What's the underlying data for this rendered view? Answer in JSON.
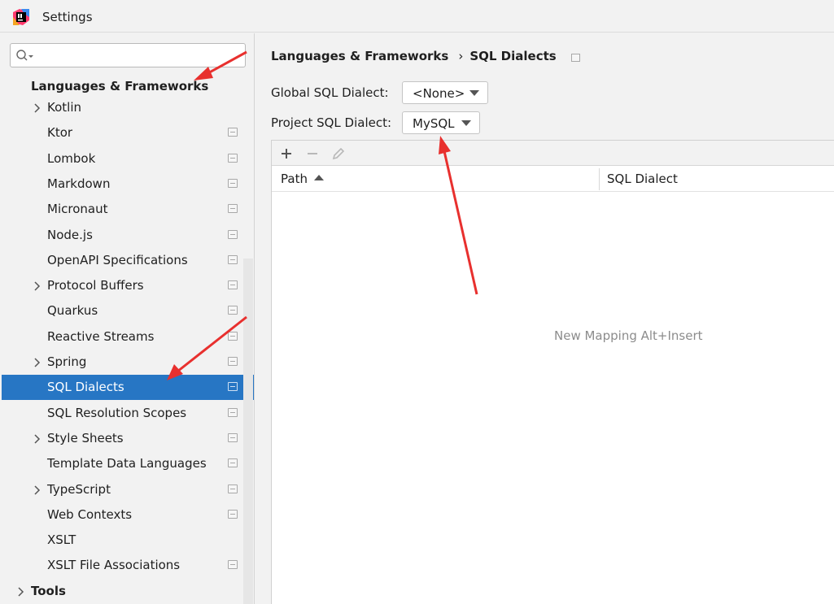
{
  "window": {
    "title": "Settings"
  },
  "search": {
    "value": "",
    "placeholder": ""
  },
  "sidebar": {
    "section_heading": "Languages & Frameworks",
    "items": [
      {
        "label": "Kotlin",
        "expandable": true,
        "page_icon": false
      },
      {
        "label": "Ktor",
        "expandable": false,
        "page_icon": true
      },
      {
        "label": "Lombok",
        "expandable": false,
        "page_icon": true
      },
      {
        "label": "Markdown",
        "expandable": false,
        "page_icon": true
      },
      {
        "label": "Micronaut",
        "expandable": false,
        "page_icon": true
      },
      {
        "label": "Node.js",
        "expandable": false,
        "page_icon": true
      },
      {
        "label": "OpenAPI Specifications",
        "expandable": false,
        "page_icon": true
      },
      {
        "label": "Protocol Buffers",
        "expandable": true,
        "page_icon": true
      },
      {
        "label": "Quarkus",
        "expandable": false,
        "page_icon": true
      },
      {
        "label": "Reactive Streams",
        "expandable": false,
        "page_icon": true
      },
      {
        "label": "Spring",
        "expandable": true,
        "page_icon": true
      },
      {
        "label": "SQL Dialects",
        "expandable": false,
        "page_icon": true,
        "selected": true
      },
      {
        "label": "SQL Resolution Scopes",
        "expandable": false,
        "page_icon": true
      },
      {
        "label": "Style Sheets",
        "expandable": true,
        "page_icon": true
      },
      {
        "label": "Template Data Languages",
        "expandable": false,
        "page_icon": true
      },
      {
        "label": "TypeScript",
        "expandable": true,
        "page_icon": true
      },
      {
        "label": "Web Contexts",
        "expandable": false,
        "page_icon": true
      },
      {
        "label": "XSLT",
        "expandable": false,
        "page_icon": false
      },
      {
        "label": "XSLT File Associations",
        "expandable": false,
        "page_icon": true
      }
    ],
    "tools_label": "Tools"
  },
  "breadcrumb": {
    "parent": "Languages & Frameworks",
    "separator": "›",
    "current": "SQL Dialects"
  },
  "form": {
    "global_label": "Global SQL Dialect:",
    "global_value": "<None>",
    "project_label": "Project SQL Dialect:",
    "project_value": "MySQL"
  },
  "table": {
    "columns": [
      "Path",
      "SQL Dialect"
    ],
    "empty_text": "New Mapping Alt+Insert",
    "toolbar": {
      "add_icon": "plus-icon",
      "remove_icon": "minus-icon",
      "edit_icon": "pencil-icon"
    }
  },
  "colors": {
    "selection": "#2776c4",
    "annotation_arrow": "#e8302e",
    "empty_text": "#8c8c8c"
  }
}
